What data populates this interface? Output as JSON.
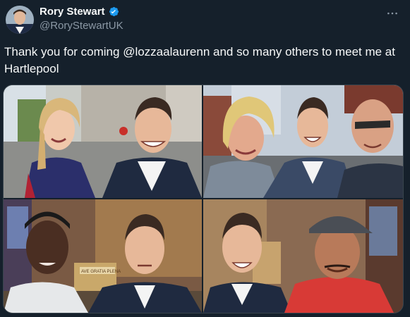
{
  "author": {
    "name": "Rory Stewart",
    "handle": "@RoryStewartUK",
    "verified": true
  },
  "tweet": {
    "text": "Thank you for coming @lozzaalaurenn and so many others to meet me at Hartlepool"
  },
  "media": {
    "photos": [
      {
        "name": "photo-1",
        "church_sign_text": ""
      },
      {
        "name": "photo-2"
      },
      {
        "name": "photo-3",
        "church_sign_text": "AVE GRATIA PLENA"
      },
      {
        "name": "photo-4"
      }
    ]
  },
  "colors": {
    "background": "#15202b",
    "text": "#f7f9f9",
    "muted": "#8b98a5",
    "verified": "#1d9bf0"
  },
  "icons": {
    "verified": "verified-badge-icon",
    "more": "more-horizontal-icon"
  }
}
